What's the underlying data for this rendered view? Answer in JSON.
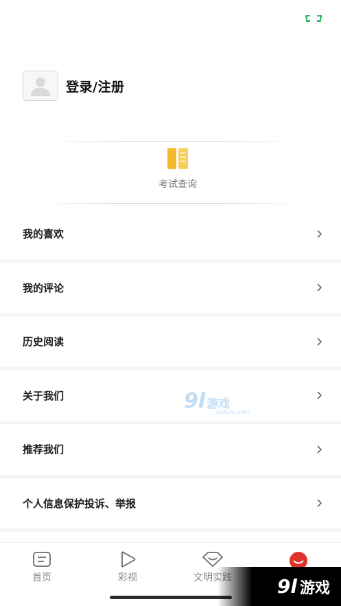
{
  "header": {
    "expand_icon": "expand-arrows-icon"
  },
  "profile": {
    "avatar_icon": "user-placeholder-icon",
    "login_label": "登录/注册"
  },
  "quick": {
    "exam_icon": "exam-books-icon",
    "exam_label": "考试查询"
  },
  "menu": {
    "items": [
      {
        "label": "我的喜欢"
      },
      {
        "label": "我的评论"
      },
      {
        "label": "历史阅读"
      },
      {
        "label": "关于我们"
      },
      {
        "label": "推荐我们"
      },
      {
        "label": "个人信息保护投诉、举报"
      }
    ]
  },
  "tabs": [
    {
      "label": "首页",
      "icon": "home-icon"
    },
    {
      "label": "彩视",
      "icon": "play-icon"
    },
    {
      "label": "文明实践",
      "icon": "heart-diamond-icon"
    },
    {
      "label": "",
      "icon": "profile-face-icon"
    }
  ],
  "watermark": {
    "num": "9l",
    "text": "游戏",
    "sub": "91danji.com"
  },
  "badge": {
    "num": "9l",
    "text": "游戏"
  },
  "colors": {
    "accent_green": "#3dbb6a",
    "exam_gold": "#f2b92b",
    "profile_red": "#e0302a"
  }
}
